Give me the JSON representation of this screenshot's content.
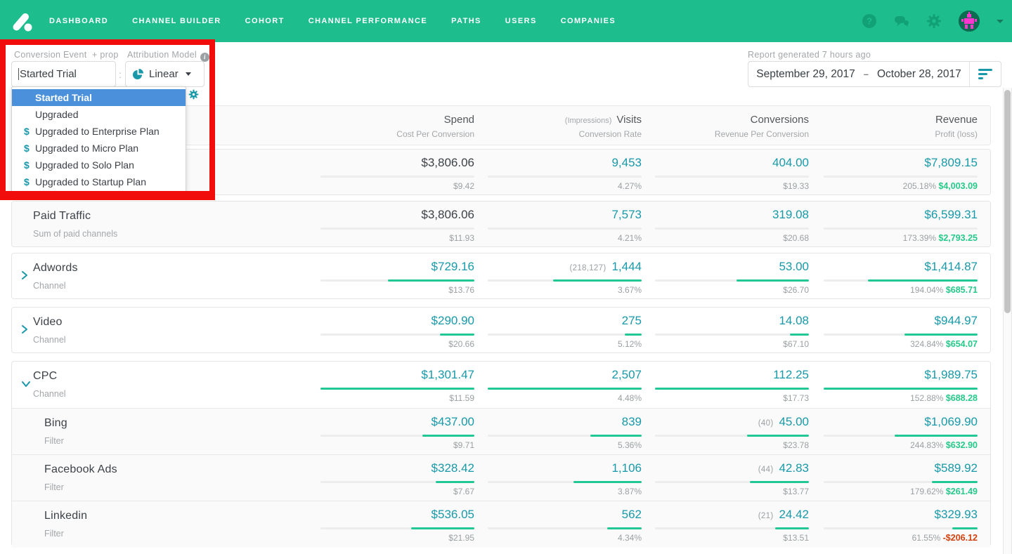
{
  "nav": {
    "items": [
      "DASHBOARD",
      "CHANNEL BUILDER",
      "COHORT",
      "CHANNEL PERFORMANCE",
      "PATHS",
      "USERS",
      "COMPANIES"
    ],
    "icons": [
      "help-icon",
      "chat-icon",
      "gear-icon",
      "avatar",
      "chevron-down-icon"
    ]
  },
  "filters": {
    "conversion_event_label": "Conversion Event",
    "prop_label": "+ prop",
    "conversion_event_value": "Started Trial",
    "separator": ":",
    "attribution_model_label": "Attribution Model",
    "attribution_model_value": "Linear",
    "mini_separator": ":",
    "dropdown_options": [
      {
        "label": "Started Trial",
        "selected": true,
        "dollar": false
      },
      {
        "label": "Upgraded",
        "selected": false,
        "dollar": false
      },
      {
        "label": "Upgraded to Enterprise Plan",
        "selected": false,
        "dollar": true
      },
      {
        "label": "Upgraded to Micro Plan",
        "selected": false,
        "dollar": true
      },
      {
        "label": "Upgraded to Solo Plan",
        "selected": false,
        "dollar": true
      },
      {
        "label": "Upgraded to Startup Plan",
        "selected": false,
        "dollar": true
      }
    ]
  },
  "report": {
    "generated_label": "Report generated 7 hours ago",
    "date_start": "September 29, 2017",
    "date_separator": "–",
    "date_end": "October 28, 2017"
  },
  "table": {
    "columns": [
      {
        "pre": "",
        "main": "Spend",
        "sub": "Cost Per Conversion"
      },
      {
        "pre": "(Impressions)",
        "main": "Visits",
        "sub": "Conversion Rate"
      },
      {
        "pre": "",
        "main": "Conversions",
        "sub": "Revenue Per Conversion"
      },
      {
        "pre": "",
        "main": "Revenue",
        "sub": "Profit (loss)"
      }
    ],
    "cards": [
      {
        "shade": true,
        "rows": [
          {
            "name": "",
            "subtitle": "",
            "type": "summary",
            "chevron": null,
            "bars": false,
            "cells": [
              {
                "value": "$3,806.06",
                "sub": "$9.42",
                "dark": true
              },
              {
                "value": "9,453",
                "sub": "4.27%"
              },
              {
                "value": "404.00",
                "sub": "$19.33"
              },
              {
                "value": "$7,809.15",
                "pct": "205.18%",
                "profit": "$4,003.09",
                "negative": false
              }
            ]
          }
        ]
      },
      {
        "shade": true,
        "rows": [
          {
            "name": "Paid Traffic",
            "subtitle": "Sum of paid channels",
            "type": "summary",
            "chevron": null,
            "bars": false,
            "cells": [
              {
                "value": "$3,806.06",
                "sub": "$11.93",
                "dark": true
              },
              {
                "value": "7,573",
                "sub": "4.21%"
              },
              {
                "value": "319.08",
                "sub": "$20.68"
              },
              {
                "value": "$6,599.31",
                "pct": "173.39%",
                "profit": "$2,793.25",
                "negative": false
              }
            ]
          }
        ]
      },
      {
        "shade": false,
        "rows": [
          {
            "name": "Adwords",
            "subtitle": "Channel",
            "type": "channel",
            "chevron": "right",
            "bars": true,
            "cells": [
              {
                "value": "$729.16",
                "sub": "$13.76"
              },
              {
                "pre": "(218,127)",
                "value": "1,444",
                "sub": "3.67%"
              },
              {
                "value": "53.00",
                "sub": "$26.70"
              },
              {
                "value": "$1,414.87",
                "pct": "194.04%",
                "profit": "$685.71",
                "negative": false
              }
            ]
          }
        ]
      },
      {
        "shade": false,
        "rows": [
          {
            "name": "Video",
            "subtitle": "Channel",
            "type": "channel",
            "chevron": "right",
            "bars": true,
            "cells": [
              {
                "value": "$290.90",
                "sub": "$20.66"
              },
              {
                "value": "275",
                "sub": "5.12%"
              },
              {
                "value": "14.08",
                "sub": "$67.10"
              },
              {
                "value": "$944.97",
                "pct": "324.84%",
                "profit": "$654.07",
                "negative": false
              }
            ]
          }
        ]
      },
      {
        "shade": false,
        "rows": [
          {
            "name": "CPC",
            "subtitle": "Channel",
            "type": "channel",
            "chevron": "down",
            "bars": true,
            "cells": [
              {
                "value": "$1,301.47",
                "sub": "$11.59"
              },
              {
                "value": "2,507",
                "sub": "4.48%"
              },
              {
                "value": "112.25",
                "sub": "$17.73"
              },
              {
                "value": "$1,989.75",
                "pct": "152.88%",
                "profit": "$688.28",
                "negative": false
              }
            ]
          },
          {
            "name": "Bing",
            "subtitle": "Filter",
            "type": "filter",
            "chevron": null,
            "bars": true,
            "cells": [
              {
                "value": "$437.00",
                "sub": "$9.71"
              },
              {
                "value": "839",
                "sub": "5.36%"
              },
              {
                "pre": "(40)",
                "value": "45.00",
                "sub": "$23.78"
              },
              {
                "value": "$1,069.90",
                "pct": "244.83%",
                "profit": "$632.90",
                "negative": false
              }
            ]
          },
          {
            "name": "Facebook Ads",
            "subtitle": "Filter",
            "type": "filter",
            "chevron": null,
            "bars": true,
            "cells": [
              {
                "value": "$328.42",
                "sub": "$7.67"
              },
              {
                "value": "1,106",
                "sub": "3.87%"
              },
              {
                "pre": "(44)",
                "value": "42.83",
                "sub": "$13.77"
              },
              {
                "value": "$589.92",
                "pct": "179.62%",
                "profit": "$261.49",
                "negative": false
              }
            ]
          },
          {
            "name": "Linkedin",
            "subtitle": "Filter",
            "type": "filter",
            "chevron": null,
            "bars": true,
            "cells": [
              {
                "value": "$536.05",
                "sub": "$21.95"
              },
              {
                "value": "562",
                "sub": "4.34%"
              },
              {
                "pre": "(21)",
                "value": "24.42",
                "sub": "$13.51"
              },
              {
                "value": "$329.93",
                "pct": "61.55%",
                "profit": "-$206.12",
                "negative": true
              }
            ]
          }
        ]
      }
    ]
  },
  "colors": {
    "nav_green": "#1dbd8d",
    "teal_link": "#1899a9",
    "bar_green": "#21c794",
    "profit_green": "#25c98a",
    "loss_red": "#d2400e",
    "selected_blue": "#4a90da",
    "annotation_red": "#f20d0d"
  }
}
